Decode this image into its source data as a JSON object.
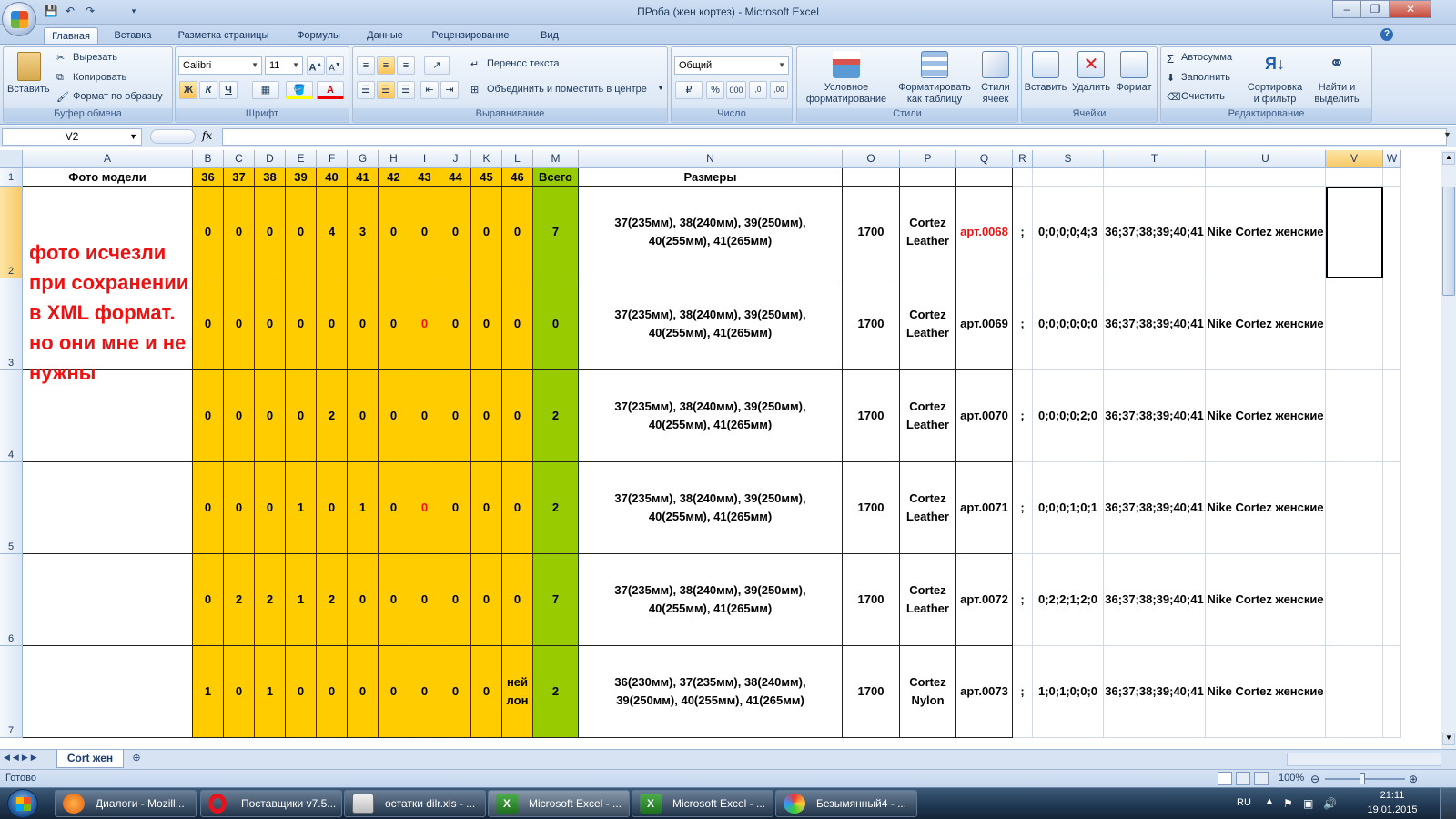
{
  "window": {
    "title": "ПРоба (жен кортез) - Microsoft Excel",
    "minimize": "–",
    "maximize": "❐",
    "close": "✕"
  },
  "quick_access": {
    "save": "💾",
    "undo": "↶",
    "redo": "↷"
  },
  "tabs": [
    "Главная",
    "Вставка",
    "Разметка страницы",
    "Формулы",
    "Данные",
    "Рецензирование",
    "Вид"
  ],
  "ribbon": {
    "clipboard": {
      "paste": "Вставить",
      "cut": "Вырезать",
      "copy": "Копировать",
      "format_painter": "Формат по образцу",
      "label": "Буфер обмена"
    },
    "font": {
      "name": "Calibri",
      "size": "11",
      "label": "Шрифт",
      "bold": "Ж",
      "italic": "К",
      "underline": "Ч"
    },
    "alignment": {
      "wrap": "Перенос текста",
      "merge": "Объединить и поместить в центре",
      "label": "Выравнивание"
    },
    "number": {
      "format": "Общий",
      "label": "Число"
    },
    "styles": {
      "conditional": "Условное форматирование",
      "as_table": "Форматировать как таблицу",
      "cell_styles": "Стили ячеек",
      "label": "Стили"
    },
    "cells": {
      "insert": "Вставить",
      "delete": "Удалить",
      "format": "Формат",
      "label": "Ячейки"
    },
    "editing": {
      "autosum": "Автосумма",
      "fill": "Заполнить",
      "clear": "Очистить",
      "sort": "Сортировка и фильтр",
      "find": "Найти и выделить",
      "label": "Редактирование"
    }
  },
  "formula_bar": {
    "name_box": "V2",
    "fx": "fx",
    "value": ""
  },
  "columns": [
    "A",
    "B",
    "C",
    "D",
    "E",
    "F",
    "G",
    "H",
    "I",
    "J",
    "K",
    "L",
    "M",
    "N",
    "O",
    "P",
    "Q",
    "R",
    "S",
    "T",
    "U",
    "V"
  ],
  "header_row": {
    "num": "1",
    "a": "Фото модели",
    "sizes": [
      "36",
      "37",
      "38",
      "39",
      "40",
      "41",
      "42",
      "43",
      "44",
      "45",
      "46"
    ],
    "total": "Всего",
    "n": "Размеры"
  },
  "note": "фото исчезли при сохранении в XML формат. но они мне и не нужны",
  "rows": [
    {
      "num": "2",
      "vals": [
        "0",
        "0",
        "0",
        "0",
        "4",
        "3",
        "0",
        "0",
        "0",
        "0",
        "0"
      ],
      "total": "7",
      "sizes": "37(235мм), 38(240мм), 39(250мм), 40(255мм), 41(265мм)",
      "price": "1700",
      "model": "Cortez Leather",
      "art": "арт.0068",
      "r": ";",
      "s": "0;0;0;0;4;3",
      "t": "36;37;38;39;40;41",
      "u": "Nike Cortez женские"
    },
    {
      "num": "3",
      "vals": [
        "0",
        "0",
        "0",
        "0",
        "0",
        "0",
        "0",
        "0",
        "0",
        "0",
        "0"
      ],
      "total": "0",
      "sizes": "37(235мм), 38(240мм), 39(250мм), 40(255мм), 41(265мм)",
      "price": "1700",
      "model": "Cortez Leather",
      "art": "арт.0069",
      "r": ";",
      "s": "0;0;0;0;0;0",
      "t": "36;37;38;39;40;41",
      "u": "Nike Cortez женские"
    },
    {
      "num": "4",
      "vals": [
        "0",
        "0",
        "0",
        "0",
        "2",
        "0",
        "0",
        "0",
        "0",
        "0",
        "0"
      ],
      "total": "2",
      "sizes": "37(235мм), 38(240мм), 39(250мм), 40(255мм), 41(265мм)",
      "price": "1700",
      "model": "Cortez Leather",
      "art": "арт.0070",
      "r": ";",
      "s": "0;0;0;0;2;0",
      "t": "36;37;38;39;40;41",
      "u": "Nike Cortez женские"
    },
    {
      "num": "5",
      "vals": [
        "0",
        "0",
        "0",
        "1",
        "0",
        "1",
        "0",
        "0",
        "0",
        "0",
        "0"
      ],
      "total": "2",
      "sizes": "37(235мм), 38(240мм), 39(250мм), 40(255мм), 41(265мм)",
      "price": "1700",
      "model": "Cortez Leather",
      "art": "арт.0071",
      "r": ";",
      "s": "0;0;0;1;0;1",
      "t": "36;37;38;39;40;41",
      "u": "Nike Cortez женские"
    },
    {
      "num": "6",
      "vals": [
        "0",
        "2",
        "2",
        "1",
        "2",
        "0",
        "0",
        "0",
        "0",
        "0",
        "0"
      ],
      "total": "7",
      "sizes": "37(235мм), 38(240мм), 39(250мм), 40(255мм), 41(265мм)",
      "price": "1700",
      "model": "Cortez Leather",
      "art": "арт.0072",
      "r": ";",
      "s": "0;2;2;1;2;0",
      "t": "36;37;38;39;40;41",
      "u": "Nike Cortez женские"
    },
    {
      "num": "7",
      "vals": [
        "1",
        "0",
        "1",
        "0",
        "0",
        "0",
        "0",
        "0",
        "0",
        "0",
        "ней лон"
      ],
      "total": "2",
      "sizes": "36(230мм), 37(235мм), 38(240мм), 39(250мм), 40(255мм), 41(265мм)",
      "price": "1700",
      "model": "Cortez Nylon",
      "art": "арт.0073",
      "r": ";",
      "s": "1;0;1;0;0;0",
      "t": "36;37;38;39;40;41",
      "u": "Nike Cortez женские"
    }
  ],
  "red_cells": [
    {
      "row": 0,
      "col": "Q"
    },
    {
      "row": 1,
      "col": "I"
    },
    {
      "row": 3,
      "col": "I"
    }
  ],
  "sheet_tab": "Cort жен",
  "status": {
    "ready": "Готово",
    "zoom": "100%"
  },
  "taskbar": {
    "items": [
      "Диалоги - Mozill...",
      "Поставщики v7.5...",
      "остатки dilr.xls - ...",
      "Microsoft Excel - ...",
      "Microsoft Excel - ...",
      "Безымянный4 - ..."
    ],
    "lang": "RU",
    "time": "21:11",
    "date": "19.01.2015"
  },
  "colors": {
    "yellow": "#ffcc00",
    "green": "#99cc00",
    "red_text": "#ee1111"
  }
}
